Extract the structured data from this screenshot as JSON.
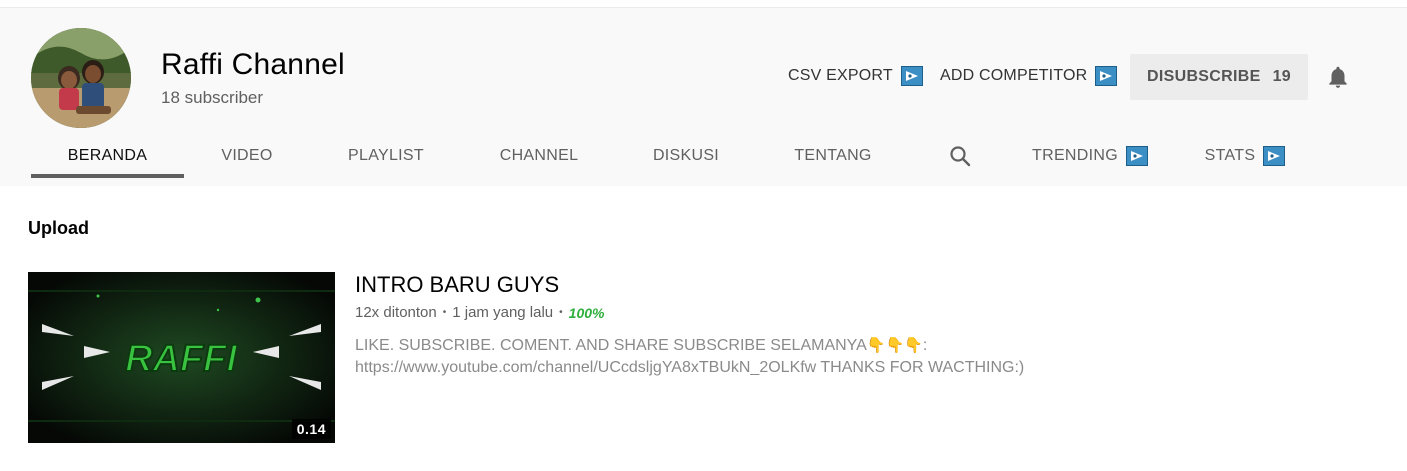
{
  "channel": {
    "name": "Raffi Channel",
    "subscribers": "18 subscriber"
  },
  "tools": {
    "csv_export": "CSV EXPORT",
    "add_competitor": "ADD COMPETITOR",
    "tool_icon": "tubebuddy-icon"
  },
  "subscribe": {
    "label": "DISUBSCRIBE",
    "count": "19"
  },
  "tabs": [
    {
      "label": "BERANDA",
      "active": true
    },
    {
      "label": "VIDEO"
    },
    {
      "label": "PLAYLIST"
    },
    {
      "label": "CHANNEL"
    },
    {
      "label": "DISKUSI"
    },
    {
      "label": "TENTANG"
    },
    {
      "label": "TRENDING"
    },
    {
      "label": "STATS"
    }
  ],
  "section": {
    "title": "Upload"
  },
  "video": {
    "title": "INTRO BARU GUYS",
    "views": "12x ditonton",
    "age": "1 jam yang lalu",
    "score": "100%",
    "duration": "0.14",
    "thumbnail_text": "RAFFI",
    "description_start": "LIKE. SUBSCRIBE. COMENT. AND SHARE SUBSCRIBE SELAMANYA",
    "description_emoji": "👇👇👇",
    "description_colon": ":",
    "description_end": "https://www.youtube.com/channel/UCcdsljgYA8xTBUkN_2OLKfw THANKS FOR WACTHING:)"
  },
  "colors": {
    "header_bg": "#f9f9f9",
    "accent_green": "#2eae3b",
    "tool_icon_blue": "#3b8fc4",
    "tab_underline": "#606060"
  }
}
